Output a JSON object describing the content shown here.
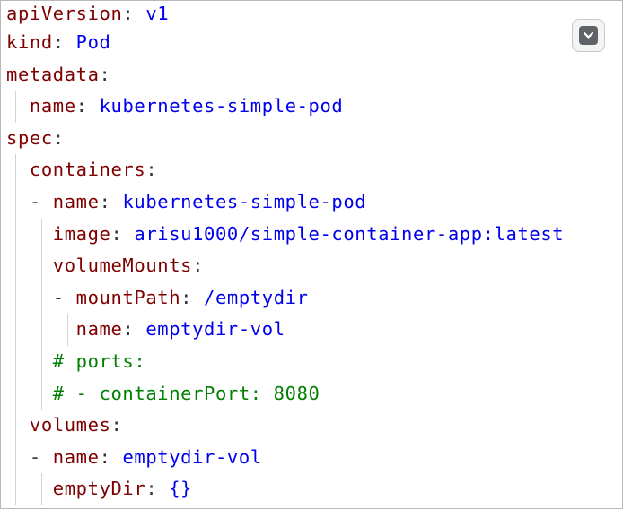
{
  "code_lines": [
    {
      "key": "apiVersion",
      "sep": ": ",
      "value": "v1"
    },
    {
      "key": "kind",
      "sep": ": ",
      "value": "Pod"
    },
    {
      "key": "metadata",
      "sep": ":"
    },
    {
      "key": "name",
      "sep": ": ",
      "value": "kubernetes-simple-pod"
    },
    {
      "key": "spec",
      "sep": ":"
    },
    {
      "key": "containers",
      "sep": ":"
    },
    {
      "dash": "- ",
      "key": "name",
      "sep": ": ",
      "value": "kubernetes-simple-pod"
    },
    {
      "key": "image",
      "sep": ": ",
      "value": "arisu1000/simple-container-app:latest"
    },
    {
      "key": "volumeMounts",
      "sep": ":"
    },
    {
      "dash": "- ",
      "key": "mountPath",
      "sep": ": ",
      "value": "/emptydir"
    },
    {
      "key": "name",
      "sep": ": ",
      "value": "emptydir-vol"
    },
    {
      "comment": "# ports:"
    },
    {
      "comment": "# - containerPort: 8080"
    },
    {
      "key": "volumes",
      "sep": ":"
    },
    {
      "dash": "- ",
      "key": "name",
      "sep": ": ",
      "value": "emptydir-vol"
    },
    {
      "key": "emptyDir",
      "sep": ": ",
      "value": "{}"
    }
  ],
  "toolbar": {
    "dropdown_icon": "chevron-down-icon"
  },
  "colors": {
    "key": "#7f0000",
    "value": "#0000ee",
    "comment": "#008000",
    "indent_guide": "#d3d3d3"
  }
}
